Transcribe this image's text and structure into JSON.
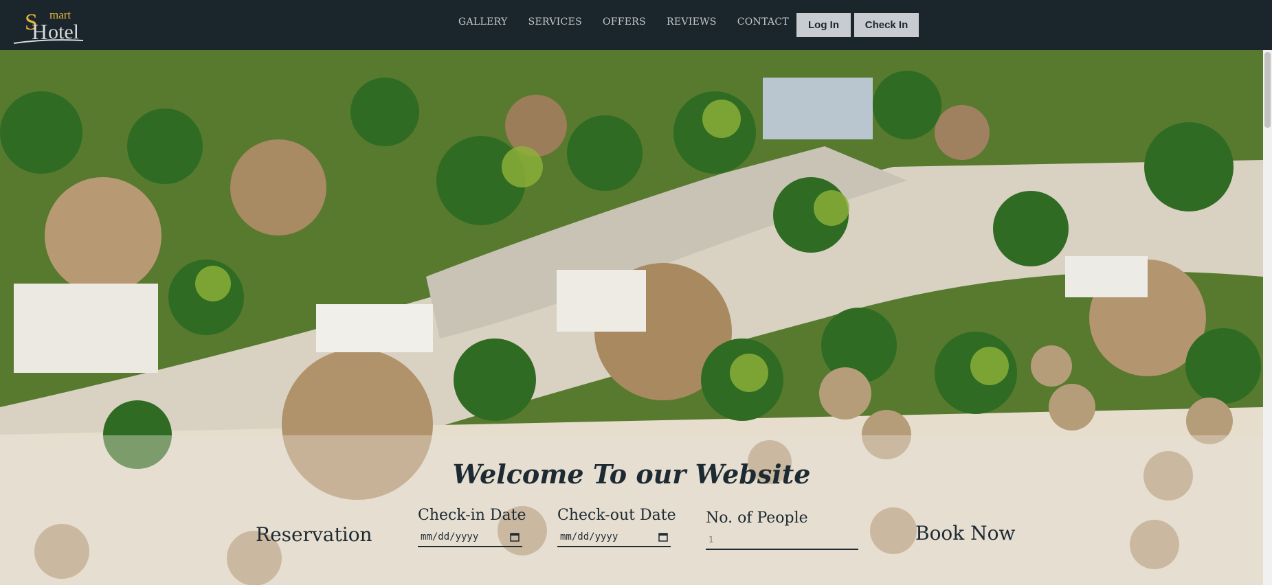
{
  "logo": {
    "big_letter": "S",
    "small_text": "mart",
    "second_letter": "H",
    "rest": "otel"
  },
  "nav": {
    "links": [
      "GALLERY",
      "SERVICES",
      "OFFERS",
      "REVIEWS",
      "CONTACT"
    ]
  },
  "auth": {
    "login": "Log In",
    "checkin": "Check In"
  },
  "hero": {
    "welcome": "Welcome To our Website"
  },
  "reservation": {
    "title": "Reservation",
    "checkin_label": "Check-in Date",
    "checkin_value": "mm/dd/yyyy",
    "checkout_label": "Check-out Date",
    "checkout_value": "mm/dd/yyyy",
    "people_label": "No. of People",
    "people_placeholder": "1",
    "book_label": "Book Now"
  },
  "colors": {
    "header_bg": "#1b252c",
    "accent_gold": "#e7b53b",
    "button_bg": "#c8cbcf",
    "text_dark": "#1d2a33"
  },
  "icons": {
    "calendar": "calendar-icon"
  }
}
